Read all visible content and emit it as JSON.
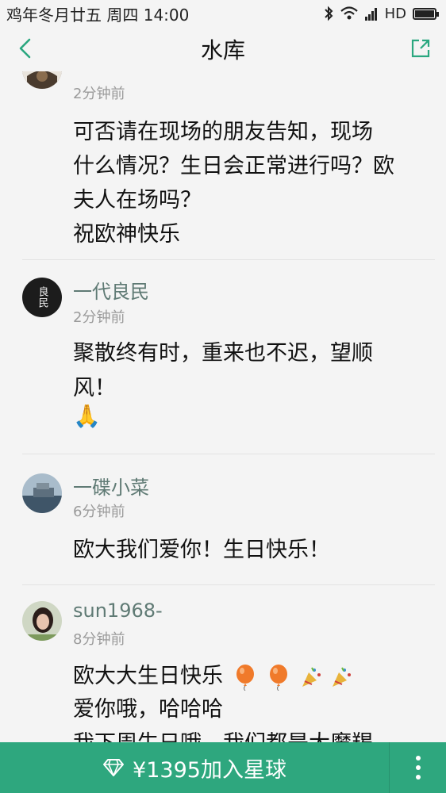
{
  "status_bar": {
    "date": "鸡年冬月廿五",
    "weekday": "周四",
    "time": "14:00",
    "network": "HD"
  },
  "header": {
    "title": "水库"
  },
  "comments": [
    {
      "time": "2分钟前",
      "lines": [
        "可否请在现场的朋友告知，现场",
        "什么情况？生日会正常进行吗？欧",
        "夫人在场吗？",
        "祝欧神快乐"
      ]
    },
    {
      "author": "一代良民",
      "avatar_text": "良民",
      "time": "2分钟前",
      "lines": [
        "聚散终有时，重来也不迟，望顺",
        "风！"
      ],
      "emoji": "🙏"
    },
    {
      "author": "一碟小菜",
      "time": "6分钟前",
      "lines": [
        "欧大我们爱你！生日快乐！"
      ]
    },
    {
      "author": "sun1968-",
      "time": "8分钟前",
      "lines": [
        "欧大大生日快乐",
        "爱你哦，哈哈哈",
        "我下周生日哦，我们都是大魔羯"
      ]
    }
  ],
  "bottom_bar": {
    "join_label": "¥1395加入星球"
  },
  "colors": {
    "accent": "#2ea77e",
    "background": "#f4f4f4",
    "author": "#5f7a74",
    "time": "#9a9a9a"
  },
  "icons": [
    "back-icon",
    "share-icon",
    "bluetooth-icon",
    "wifi-icon",
    "signal-icon",
    "battery-icon",
    "diamond-icon",
    "more-icon"
  ]
}
